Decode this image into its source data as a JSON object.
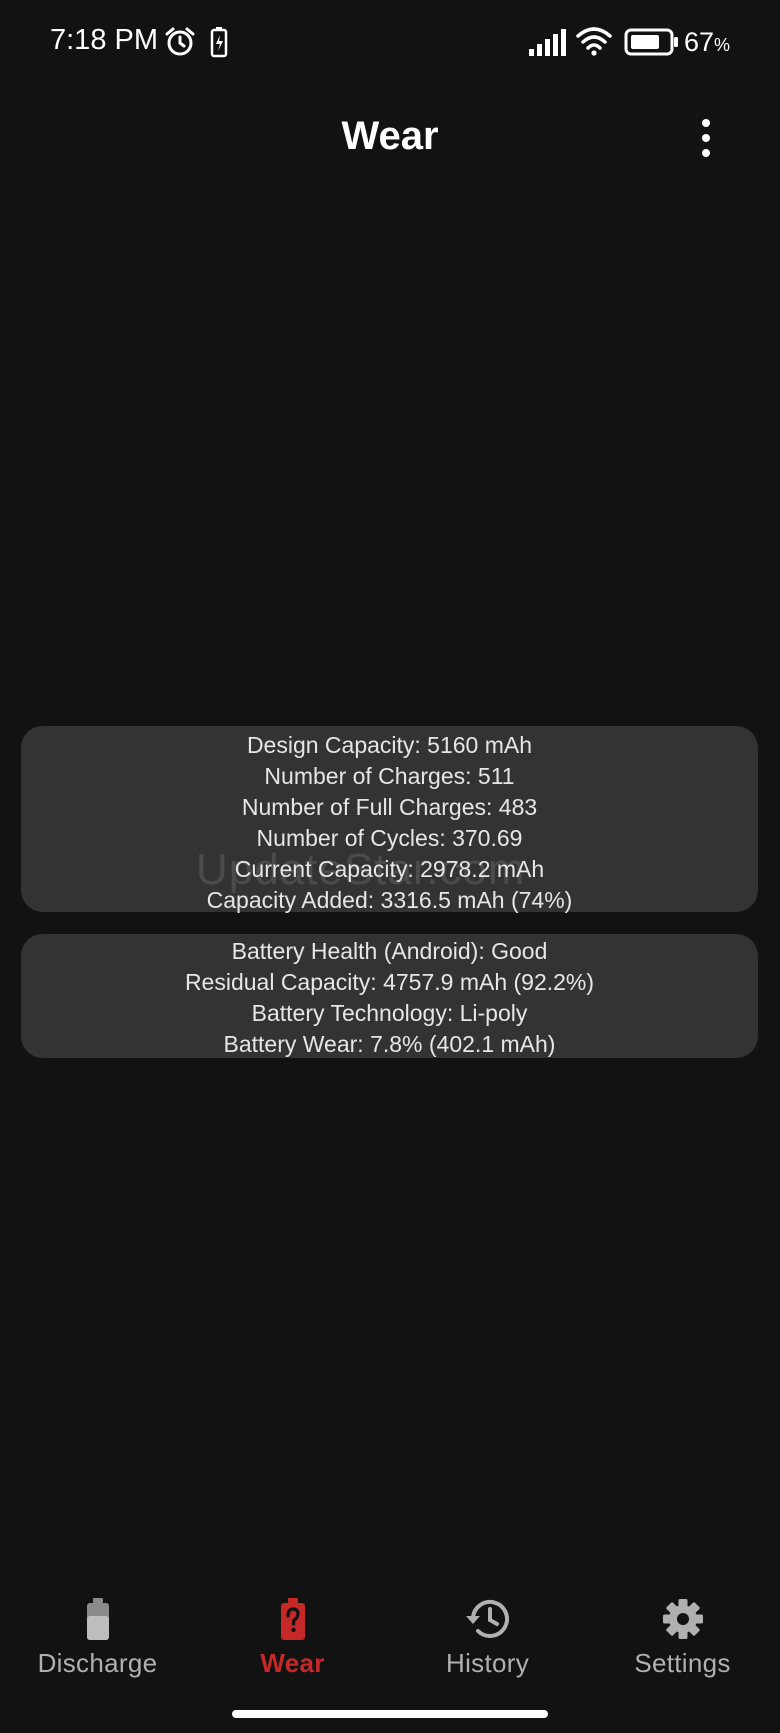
{
  "status_bar": {
    "time": "7:18 PM",
    "battery_percent": "67",
    "battery_percent_sign": "%",
    "icons": [
      "alarm-icon",
      "charging-icon",
      "signal-icon",
      "wifi-icon",
      "battery-icon"
    ]
  },
  "app_bar": {
    "title": "Wear",
    "menu_icon": "more-vert-icon"
  },
  "capacity_card": {
    "lines": [
      "Design Capacity: 5160 mAh",
      "Number of Charges: 511",
      "Number of Full Charges: 483",
      "Number of Cycles: 370.69",
      "Current Capacity: 2978.2 mAh",
      "Capacity Added: 3316.5 mAh (74%)"
    ]
  },
  "health_card": {
    "lines": [
      "Battery Health (Android): Good",
      "Residual Capacity: 4757.9 mAh (92.2%)",
      "Battery Technology: Li-poly",
      "Battery Wear: 7.8% (402.1 mAh)"
    ]
  },
  "watermark": "UpdateStar.com",
  "bottom_nav": {
    "items": [
      {
        "label": "Discharge",
        "icon": "battery-icon",
        "active": false
      },
      {
        "label": "Wear",
        "icon": "battery-question-icon",
        "active": true
      },
      {
        "label": "History",
        "icon": "history-icon",
        "active": false
      },
      {
        "label": "Settings",
        "icon": "gear-icon",
        "active": false
      }
    ]
  },
  "colors": {
    "background": "#121212",
    "card": "#333333",
    "accent": "#c62828",
    "nav_inactive": "#b0b0b0"
  }
}
